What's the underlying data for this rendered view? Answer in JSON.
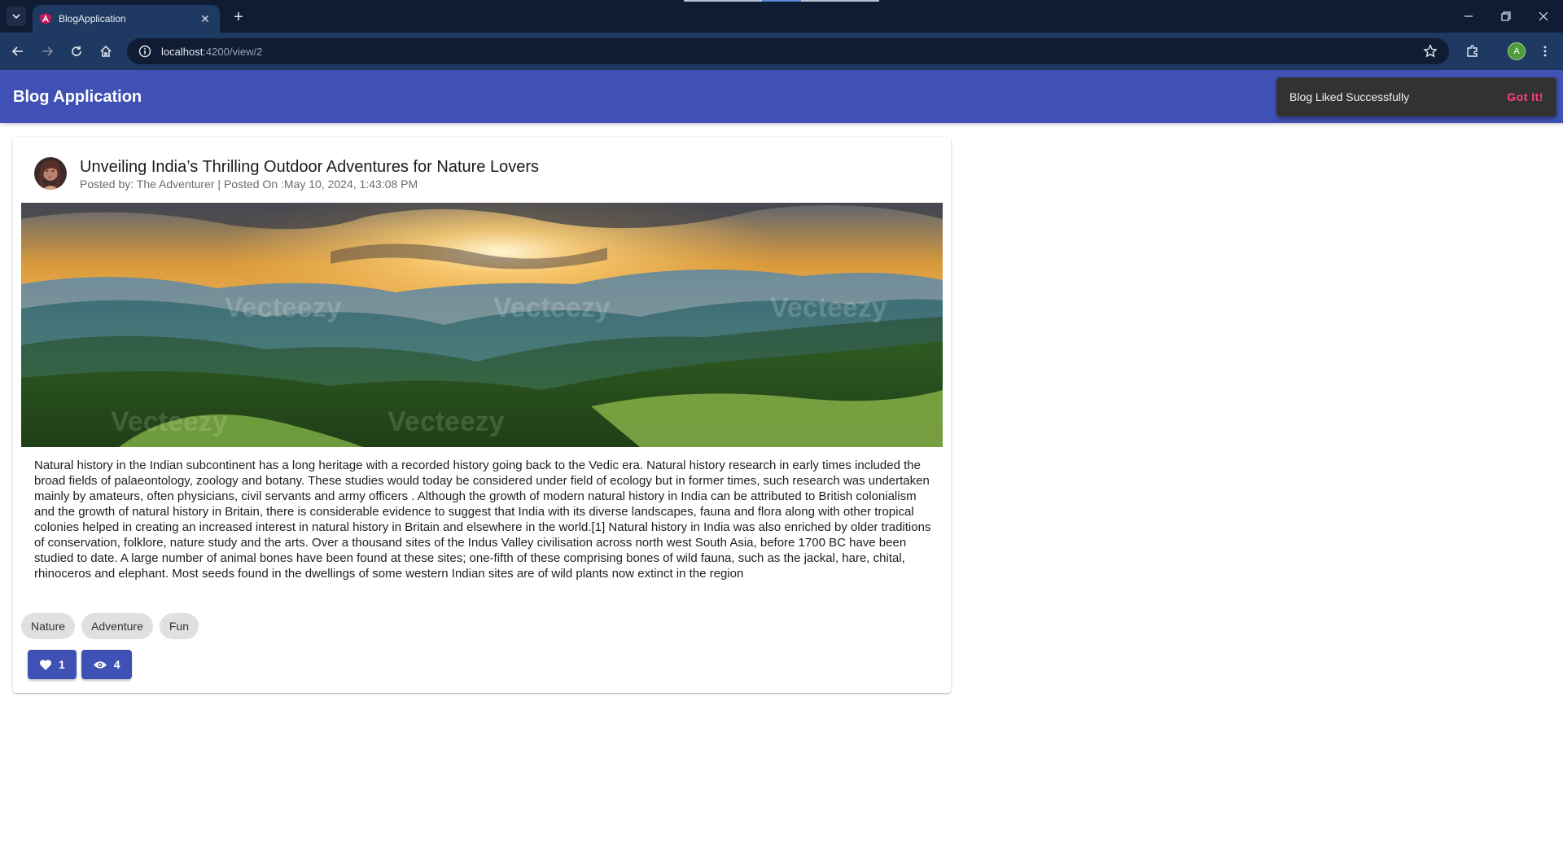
{
  "browser": {
    "tab_title": "BlogApplication",
    "url_host": "localhost",
    "url_path": ":4200/view/2",
    "profile_initial": "A",
    "accent": "#1f3a62"
  },
  "app": {
    "title": "Blog Application",
    "toolbar_color": "#3f51b5"
  },
  "snackbar": {
    "message": "Blog Liked Successfully",
    "action": "Got It!"
  },
  "post": {
    "title": "Unveiling India’s Thrilling Outdoor Adventures for Nature Lovers",
    "posted_by_label": "Posted by: ",
    "author": "The Adventurer",
    "separator": " | ",
    "posted_on_label": "Posted On :",
    "date": "May 10, 2024, 1:43:08 PM",
    "body": "Natural history in the Indian subcontinent has a long heritage with a recorded history going back to the Vedic era. Natural history research in early times included the broad fields of palaeontology, zoology and botany. These studies would today be considered under field of ecology but in former times, such research was undertaken mainly by amateurs, often physicians, civil servants and army officers . Although the growth of modern natural history in India can be attributed to British colonialism and the growth of natural history in Britain, there is considerable evidence to suggest that India with its diverse landscapes, fauna and flora along with other tropical colonies helped in creating an increased interest in natural history in Britain and elsewhere in the world.[1] Natural history in India was also enriched by older traditions of conservation, folklore, nature study and the arts. Over a thousand sites of the Indus Valley civilisation across north west South Asia, before 1700 BC have been studied to date. A large number of animal bones have been found at these sites; one-fifth of these comprising bones of wild fauna, such as the jackal, hare, chital, rhinoceros and elephant. Most seeds found in the dwellings of some western Indian sites are of wild plants now extinct in the region",
    "tags": [
      "Nature",
      "Adventure",
      "Fun"
    ],
    "likes": "1",
    "views": "4",
    "image_watermark": "Vecteezy"
  }
}
